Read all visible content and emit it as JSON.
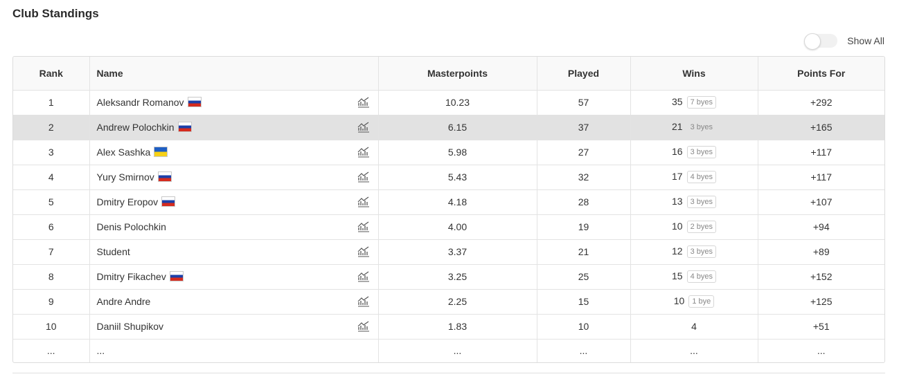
{
  "title": "Club Standings",
  "show_all": {
    "label": "Show All",
    "on": false
  },
  "table": {
    "headers": {
      "rank": "Rank",
      "name": "Name",
      "masterpoints": "Masterpoints",
      "played": "Played",
      "wins": "Wins",
      "points_for": "Points For"
    },
    "rows": [
      {
        "rank": "1",
        "name": "Aleksandr Romanov",
        "flag": "russia",
        "masterpoints": "10.23",
        "played": "57",
        "wins": "35",
        "byes": "7 byes",
        "points_for": "+292"
      },
      {
        "rank": "2",
        "name": "Andrew Polochkin",
        "flag": "russia",
        "masterpoints": "6.15",
        "played": "37",
        "wins": "21",
        "byes": "3 byes",
        "points_for": "+165",
        "highlighted": true
      },
      {
        "rank": "3",
        "name": "Alex Sashka",
        "flag": "ukraine",
        "masterpoints": "5.98",
        "played": "27",
        "wins": "16",
        "byes": "3 byes",
        "points_for": "+117"
      },
      {
        "rank": "4",
        "name": "Yury Smirnov",
        "flag": "russia",
        "masterpoints": "5.43",
        "played": "32",
        "wins": "17",
        "byes": "4 byes",
        "points_for": "+117"
      },
      {
        "rank": "5",
        "name": "Dmitry Eropov",
        "flag": "russia",
        "masterpoints": "4.18",
        "played": "28",
        "wins": "13",
        "byes": "3 byes",
        "points_for": "+107"
      },
      {
        "rank": "6",
        "name": "Denis Polochkin",
        "flag": "",
        "masterpoints": "4.00",
        "played": "19",
        "wins": "10",
        "byes": "2 byes",
        "points_for": "+94"
      },
      {
        "rank": "7",
        "name": "Student",
        "flag": "",
        "masterpoints": "3.37",
        "played": "21",
        "wins": "12",
        "byes": "3 byes",
        "points_for": "+89"
      },
      {
        "rank": "8",
        "name": "Dmitry Fikachev",
        "flag": "russia",
        "masterpoints": "3.25",
        "played": "25",
        "wins": "15",
        "byes": "4 byes",
        "points_for": "+152"
      },
      {
        "rank": "9",
        "name": "Andre Andre",
        "flag": "",
        "masterpoints": "2.25",
        "played": "15",
        "wins": "10",
        "byes": "1 bye",
        "points_for": "+125"
      },
      {
        "rank": "10",
        "name": "Daniil Shupikov",
        "flag": "",
        "masterpoints": "1.83",
        "played": "10",
        "wins": "4",
        "byes": "",
        "points_for": "+51"
      }
    ],
    "ellipsis": "..."
  },
  "icons": {
    "stats": "stats-chart-icon",
    "flags": [
      "russia-flag-icon",
      "ukraine-flag-icon"
    ]
  }
}
